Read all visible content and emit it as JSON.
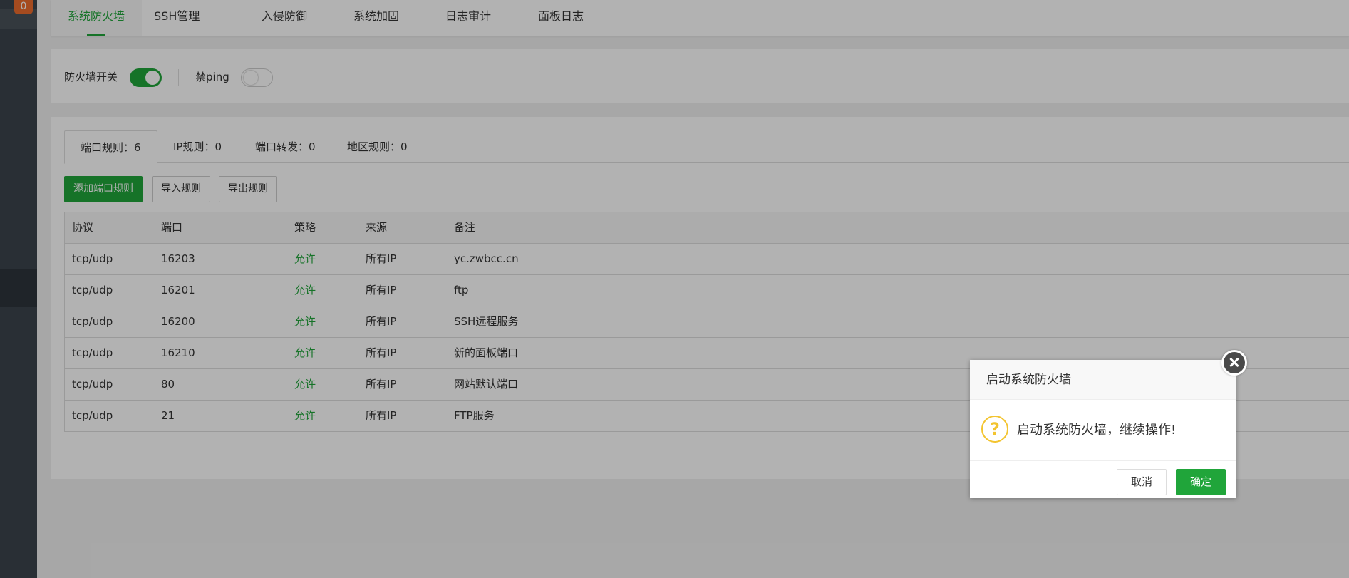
{
  "sidebar": {
    "badge": "0"
  },
  "topnav": {
    "tabs": [
      {
        "label": "系统防火墙"
      },
      {
        "label": "SSH管理"
      },
      {
        "label": "入侵防御"
      },
      {
        "label": "系统加固"
      },
      {
        "label": "日志审计"
      },
      {
        "label": "面板日志"
      }
    ]
  },
  "switches": {
    "firewall_label": "防火墙开关",
    "firewall_on": true,
    "ping_label": "禁ping",
    "ping_on": false
  },
  "subtabs": [
    {
      "label": "端口规则：6"
    },
    {
      "label": "IP规则：0"
    },
    {
      "label": "端口转发：0"
    },
    {
      "label": "地区规则：0"
    }
  ],
  "actions": {
    "add": "添加端口规则",
    "import": "导入规则",
    "export": "导出规则"
  },
  "table": {
    "headers": [
      "协议",
      "端口",
      "策略",
      "来源",
      "备注"
    ],
    "rows": [
      {
        "protocol": "tcp/udp",
        "port": "16203",
        "policy": "允许",
        "source": "所有IP",
        "note": "yc.zwbcc.cn"
      },
      {
        "protocol": "tcp/udp",
        "port": "16201",
        "policy": "允许",
        "source": "所有IP",
        "note": "ftp"
      },
      {
        "protocol": "tcp/udp",
        "port": "16200",
        "policy": "允许",
        "source": "所有IP",
        "note": "SSH远程服务"
      },
      {
        "protocol": "tcp/udp",
        "port": "16210",
        "policy": "允许",
        "source": "所有IP",
        "note": "新的面板端口"
      },
      {
        "protocol": "tcp/udp",
        "port": "80",
        "policy": "允许",
        "source": "所有IP",
        "note": "网站默认端口"
      },
      {
        "protocol": "tcp/udp",
        "port": "21",
        "policy": "允许",
        "source": "所有IP",
        "note": "FTP服务"
      }
    ]
  },
  "dialog": {
    "title": "启动系统防火墙",
    "message": "启动系统防火墙，继续操作!",
    "icon": "?",
    "cancel": "取消",
    "confirm": "确定"
  },
  "colors": {
    "accent": "#20a53a",
    "sidebar": "#3c444d",
    "warning": "#f3c42f",
    "badge": "#ec6c2d"
  }
}
